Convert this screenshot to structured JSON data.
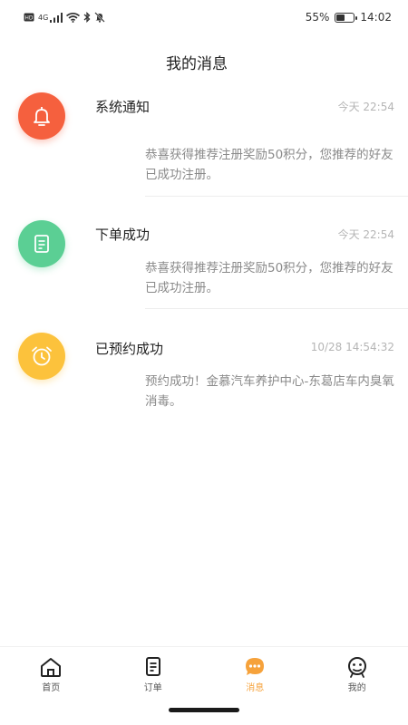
{
  "status_bar": {
    "network": "4G",
    "battery": "55%",
    "battery_level": 0.55,
    "time": "14:02"
  },
  "page": {
    "title": "我的消息"
  },
  "messages": [
    {
      "title": "系统通知",
      "time": "今天 22:54",
      "body": "恭喜获得推荐注册奖励50积分，您推荐的好友已成功注册。",
      "icon": "bell-icon",
      "color": "#f5603e"
    },
    {
      "title": "下单成功",
      "time": "今天 22:54",
      "body": "恭喜获得推荐注册奖励50积分，您推荐的好友已成功注册。",
      "icon": "order-icon",
      "color": "#5bcf94"
    },
    {
      "title": "已预约成功",
      "time": "10/28 14:54:32",
      "body": "预约成功！金慕汽车养护中心-东葛店车内臭氧消毒。",
      "icon": "alarm-clock-icon",
      "color": "#fcc23c"
    }
  ],
  "tab_bar": {
    "tabs": [
      {
        "label": "首页",
        "icon": "home-icon"
      },
      {
        "label": "订单",
        "icon": "order-icon"
      },
      {
        "label": "消息",
        "icon": "message-icon",
        "active": true
      },
      {
        "label": "我的",
        "icon": "profile-icon"
      }
    ],
    "active_color": "#f6a23b"
  }
}
